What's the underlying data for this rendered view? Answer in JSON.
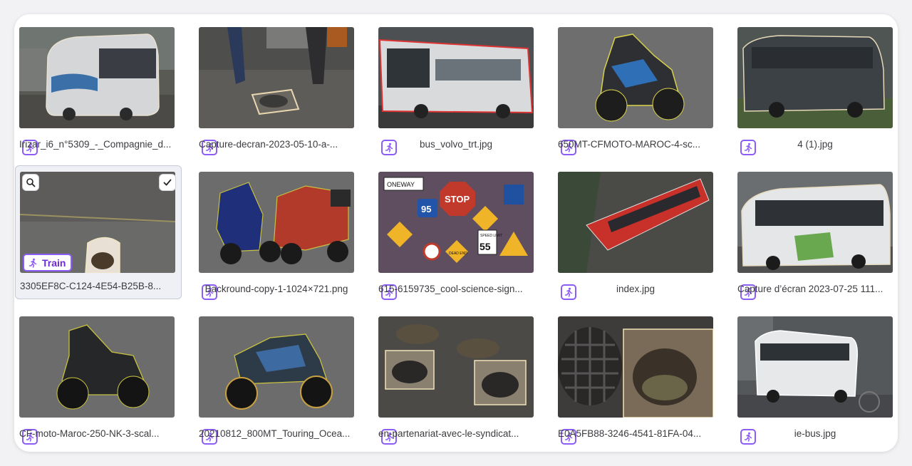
{
  "accent": "#8b5cf6",
  "cards": [
    {
      "filename": "Irizar_i6_n°5309_-_Compagnie_d...",
      "align": "left",
      "badge": "run-icon"
    },
    {
      "filename": "Capture-decran-2023-05-10-a-...",
      "align": "left",
      "badge": "run-icon"
    },
    {
      "filename": "bus_volvo_trt.jpg",
      "align": "center",
      "badge": "run-icon"
    },
    {
      "filename": "650MT-CFMOTO-MAROC-4-sc...",
      "align": "left",
      "badge": "run-icon"
    },
    {
      "filename": "4 (1).jpg",
      "align": "center",
      "badge": "run-icon"
    },
    {
      "filename": "3305EF8C-C124-4E54-B25B-8...",
      "align": "left",
      "badge": "run-icon",
      "badge_text": "Train",
      "selected": true
    },
    {
      "filename": "Backround-copy-1-1024×721.png",
      "align": "center",
      "badge": "run-icon"
    },
    {
      "filename": "615-6159735_cool-science-sign...",
      "align": "left",
      "badge": "run-icon"
    },
    {
      "filename": "index.jpg",
      "align": "center",
      "badge": "run-icon"
    },
    {
      "filename": "Capture d’écran 2023-07-25 111...",
      "align": "left",
      "badge": "run-icon"
    },
    {
      "filename": "CF-moto-Maroc-250-NK-3-scal...",
      "align": "left",
      "badge": "run-icon"
    },
    {
      "filename": "20210812_800MT_Touring_Ocea...",
      "align": "left",
      "badge": "run-icon"
    },
    {
      "filename": "en-partenariat-avec-le-syndicat...",
      "align": "left",
      "badge": "run-icon"
    },
    {
      "filename": "E0A5FB88-3246-4541-81FA-04...",
      "align": "left",
      "badge": "run-icon"
    },
    {
      "filename": "ie-bus.jpg",
      "align": "center",
      "badge": "run-icon"
    }
  ],
  "sign_text": {
    "oneway": "ONEWAY",
    "stop": "STOP",
    "route": "95",
    "speed_limit": "SPEED LIMIT",
    "speed": "55",
    "dead_end": "DEAD END"
  }
}
